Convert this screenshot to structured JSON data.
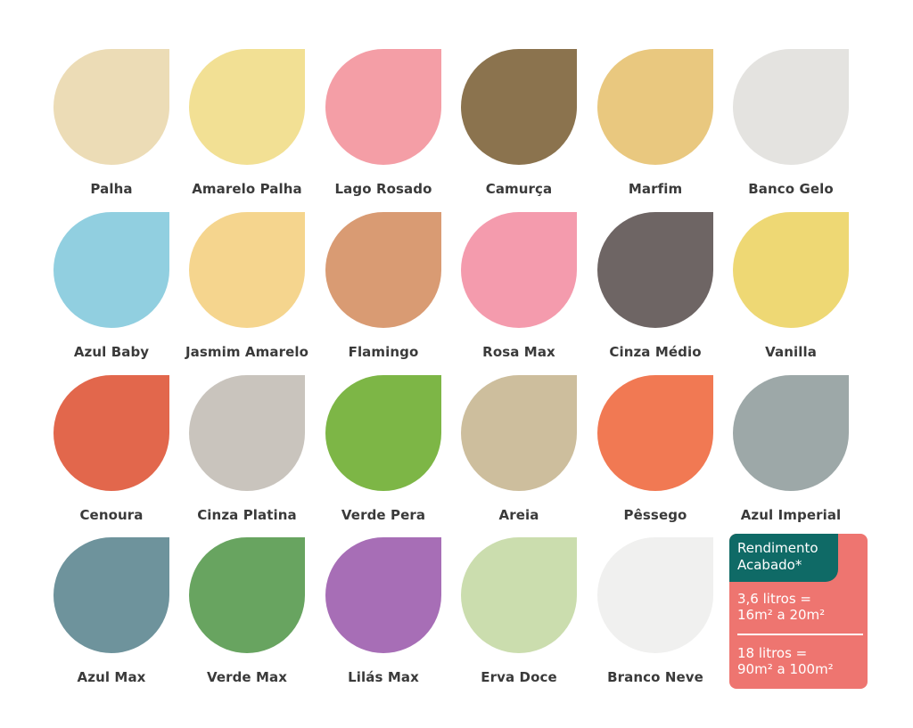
{
  "swatches": [
    {
      "name": "Palha",
      "color": "#ecdcb6"
    },
    {
      "name": "Amarelo Palha",
      "color": "#f2e094"
    },
    {
      "name": "Lago Rosado",
      "color": "#f49ea6"
    },
    {
      "name": "Camurça",
      "color": "#8b734e"
    },
    {
      "name": "Marfim",
      "color": "#e9c87f"
    },
    {
      "name": "Banco Gelo",
      "color": "#e4e3e0"
    },
    {
      "name": "Azul Baby",
      "color": "#91cfe0"
    },
    {
      "name": "Jasmim Amarelo",
      "color": "#f5d58e"
    },
    {
      "name": "Flamingo",
      "color": "#d99b73"
    },
    {
      "name": "Rosa Max",
      "color": "#f49bad"
    },
    {
      "name": "Cinza Médio",
      "color": "#6e6564"
    },
    {
      "name": "Vanilla",
      "color": "#eed874"
    },
    {
      "name": "Cenoura",
      "color": "#e2674c"
    },
    {
      "name": "Cinza Platina",
      "color": "#c9c4bd"
    },
    {
      "name": "Verde Pera",
      "color": "#7db646"
    },
    {
      "name": "Areia",
      "color": "#cdbe9d"
    },
    {
      "name": "Pêssego",
      "color": "#f17953"
    },
    {
      "name": "Azul Imperial",
      "color": "#9da8a8"
    },
    {
      "name": "Azul Max",
      "color": "#6e939c"
    },
    {
      "name": "Verde Max",
      "color": "#68a460"
    },
    {
      "name": "Lilás Max",
      "color": "#a76eb6"
    },
    {
      "name": "Erva Doce",
      "color": "#cbddae"
    },
    {
      "name": "Branco Neve",
      "color": "#f0f0ef"
    }
  ],
  "info": {
    "title_line1": "Rendimento",
    "title_line2": "Acabado*",
    "small_line1": "3,6 litros =",
    "small_line2": "16m² a 20m²",
    "large_line1": "18 litros =",
    "large_line2": "90m² a 100m²",
    "colors": {
      "panel": "#ee7570",
      "header": "#0f6a66"
    }
  }
}
